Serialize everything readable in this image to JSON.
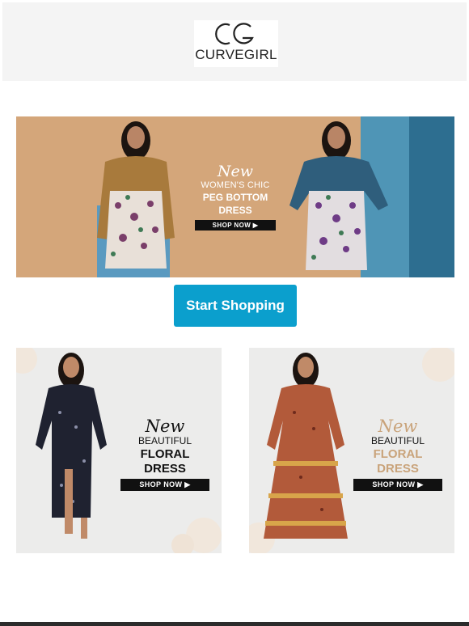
{
  "brand": {
    "name": "CURVEGIRL"
  },
  "hero": {
    "script": "New",
    "line1": "WOMEN'S CHIC",
    "line2": "PEG BOTTOM DRESS",
    "shop_label": "SHOP NOW ▶"
  },
  "cta": {
    "label": "Start Shopping"
  },
  "products": [
    {
      "script": "New",
      "line1": "BEAUTIFUL",
      "line2": "FLORAL DRESS",
      "shop_label": "SHOP NOW ▶"
    },
    {
      "script": "New",
      "line1": "BEAUTIFUL",
      "line2": "FLORAL DRESS",
      "shop_label": "SHOP NOW ▶"
    }
  ],
  "colors": {
    "cta": "#0b9fcd",
    "header_bg": "#f4f4f4",
    "hero_bg": "#d4a67a",
    "accent_gold": "#c9a37a"
  }
}
